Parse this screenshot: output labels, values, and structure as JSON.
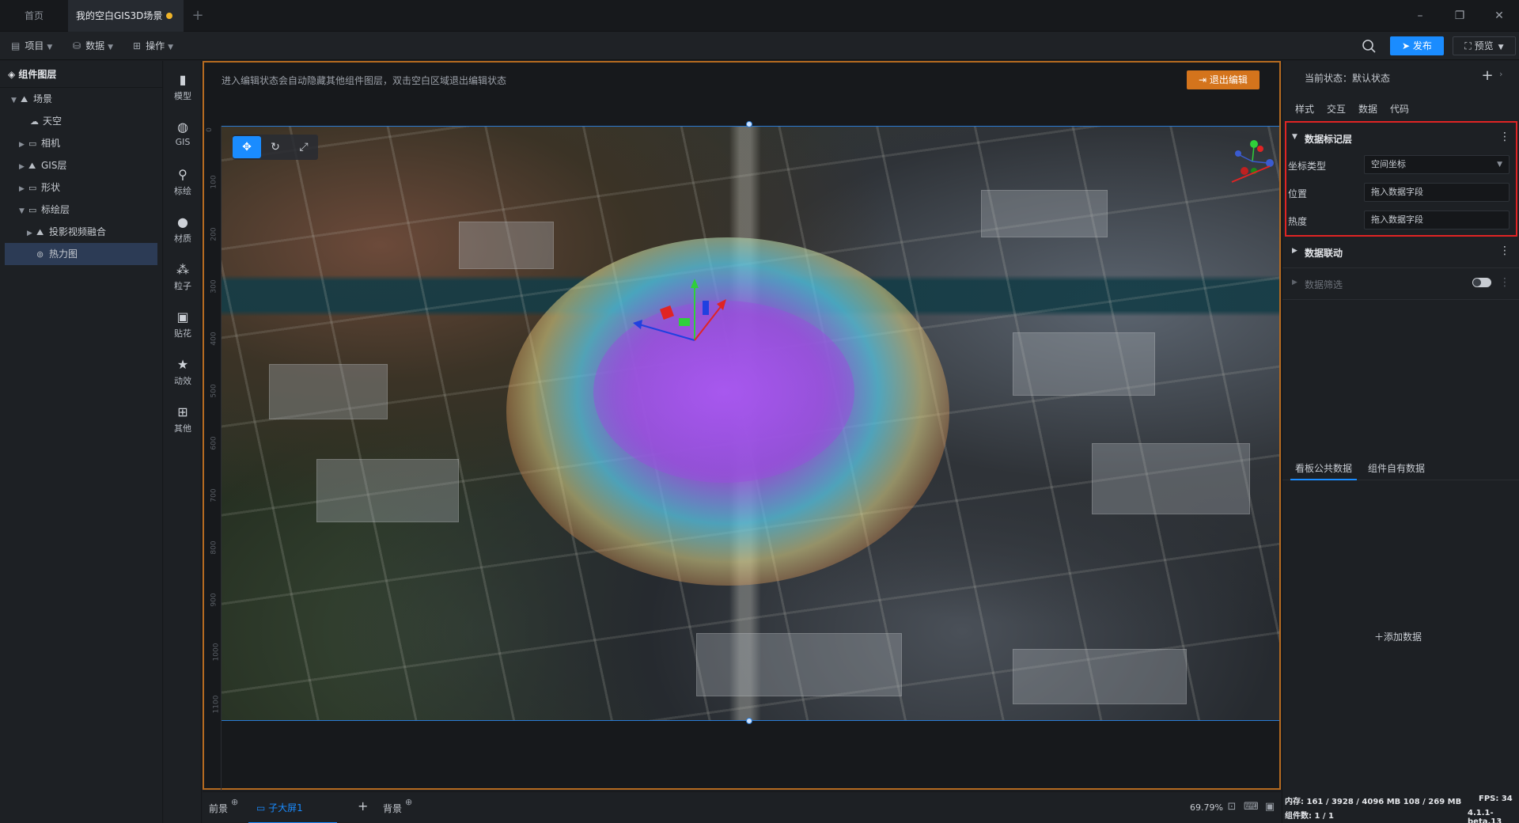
{
  "tabs": {
    "home": "首页",
    "scene": "我的空白GIS3D场景",
    "add": "+"
  },
  "window": {
    "minimize": "–",
    "restore": "❐",
    "close": "✕"
  },
  "toolbar": {
    "project": "项目",
    "data": "数据",
    "operation": "操作",
    "publish": "发布",
    "preview": "预览"
  },
  "layers": {
    "title": "组件图层",
    "items": [
      {
        "label": "场景",
        "icon": "scene-icon"
      },
      {
        "label": "天空",
        "icon": "sky-icon"
      },
      {
        "label": "相机",
        "icon": "folder-icon"
      },
      {
        "label": "GIS层",
        "icon": "gis-layer-icon"
      },
      {
        "label": "形状",
        "icon": "folder-icon"
      },
      {
        "label": "标绘层",
        "icon": "folder-icon"
      },
      {
        "label": "投影视频融合",
        "icon": "projection-icon"
      },
      {
        "label": "热力图",
        "icon": "heatmap-icon"
      }
    ]
  },
  "toolbox": [
    {
      "label": "模型",
      "icon": "model-icon"
    },
    {
      "label": "GIS",
      "icon": "globe-icon"
    },
    {
      "label": "标绘",
      "icon": "pin-icon"
    },
    {
      "label": "材质",
      "icon": "material-icon"
    },
    {
      "label": "粒子",
      "icon": "particle-icon"
    },
    {
      "label": "贴花",
      "icon": "decal-icon"
    },
    {
      "label": "动效",
      "icon": "star-icon"
    },
    {
      "label": "其他",
      "icon": "grid-icon"
    }
  ],
  "canvas": {
    "tip": "进入编辑状态会自动隐藏其他组件图层，双击空白区域退出编辑状态",
    "exit_edit": "退出编辑",
    "ruler_v": [
      "0",
      "100",
      "200",
      "300",
      "400",
      "500",
      "600",
      "700",
      "800",
      "900",
      "1000",
      "1100"
    ]
  },
  "props": {
    "state_label": "当前状态：默认状态",
    "tabs": [
      "样式",
      "交互",
      "数据",
      "代码"
    ],
    "marker_section": "数据标记层",
    "coord_type_label": "坐标类型",
    "coord_type_value": "空间坐标",
    "position_label": "位置",
    "position_value": "拖入数据字段",
    "heat_label": "热度",
    "heat_value": "拖入数据字段",
    "linkage_section": "数据联动",
    "filter_section": "数据筛选",
    "data_tab_public": "看板公共数据",
    "data_tab_own": "组件自有数据",
    "add_data": "添加数据"
  },
  "bottom": {
    "front": "前景",
    "child": "子大屏1",
    "add": "+",
    "back": "背景",
    "zoom": "69.79%"
  },
  "status": {
    "memory": "内存: 161 / 3928 / 4096 MB 108 / 269 MB",
    "fps": "FPS: 34",
    "components": "组件数: 1 / 1",
    "version": "4.1.1-beta.13"
  },
  "colors": {
    "accent": "#1a8cff",
    "edit_border": "#b56a20",
    "exit_button": "#d4741c",
    "marker": "#e02424"
  }
}
